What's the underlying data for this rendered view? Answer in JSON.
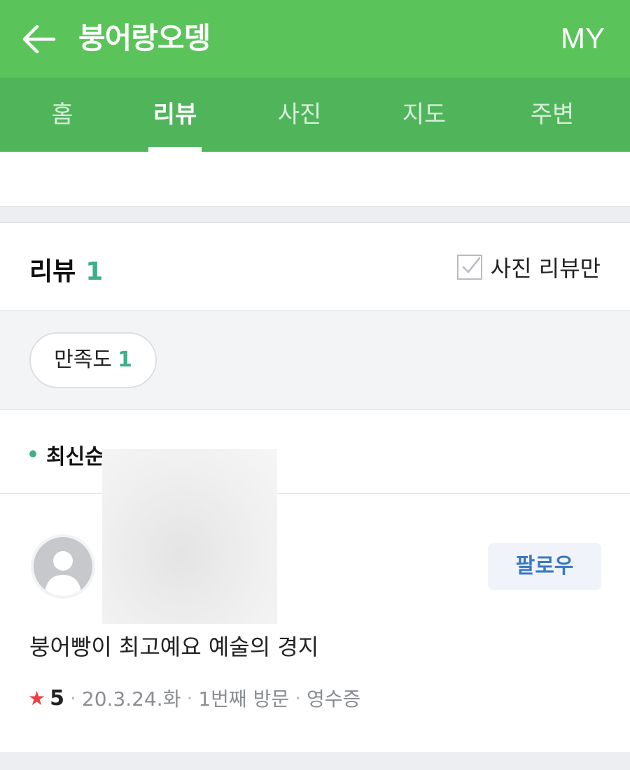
{
  "header": {
    "title": "붕어랑오뎅",
    "my_label": "MY",
    "background": "#5ac45a"
  },
  "tabs": [
    {
      "label": "홈"
    },
    {
      "label": "리뷰"
    },
    {
      "label": "사진"
    },
    {
      "label": "지도"
    },
    {
      "label": "주변"
    }
  ],
  "active_tab": "리뷰",
  "review_section": {
    "title": "리뷰",
    "count": "1",
    "photo_only_label": "사진 리뷰만"
  },
  "filter": {
    "chip_label": "만족도",
    "chip_count": "1"
  },
  "sort": {
    "label": "최신순"
  },
  "review": {
    "follow_label": "팔로우",
    "text": "붕어빵이 최고예요 예술의 경지",
    "rating": "5",
    "date": "20.3.24.화",
    "visit": "1번째 방문",
    "receipt": "영수증"
  }
}
